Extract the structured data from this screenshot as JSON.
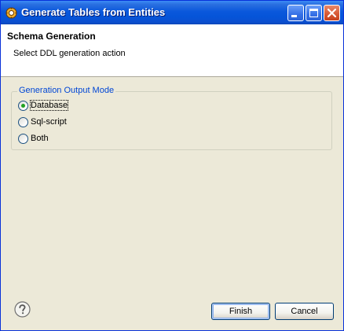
{
  "window": {
    "title": "Generate Tables from Entities"
  },
  "header": {
    "title": "Schema Generation",
    "description": "Select DDL generation action"
  },
  "group": {
    "legend": "Generation Output Mode",
    "options": [
      {
        "label": "Database",
        "checked": true
      },
      {
        "label": "Sql-script",
        "checked": false
      },
      {
        "label": "Both",
        "checked": false
      }
    ]
  },
  "footer": {
    "finish_label": "Finish",
    "cancel_label": "Cancel"
  },
  "colors": {
    "titlebar": "#0554d8",
    "legend": "#0046d5",
    "radio_dot": "#21a121",
    "window_bg": "#ece9d8"
  },
  "icons": {
    "title": "eclipse-gear-icon",
    "help": "question-mark-icon"
  }
}
